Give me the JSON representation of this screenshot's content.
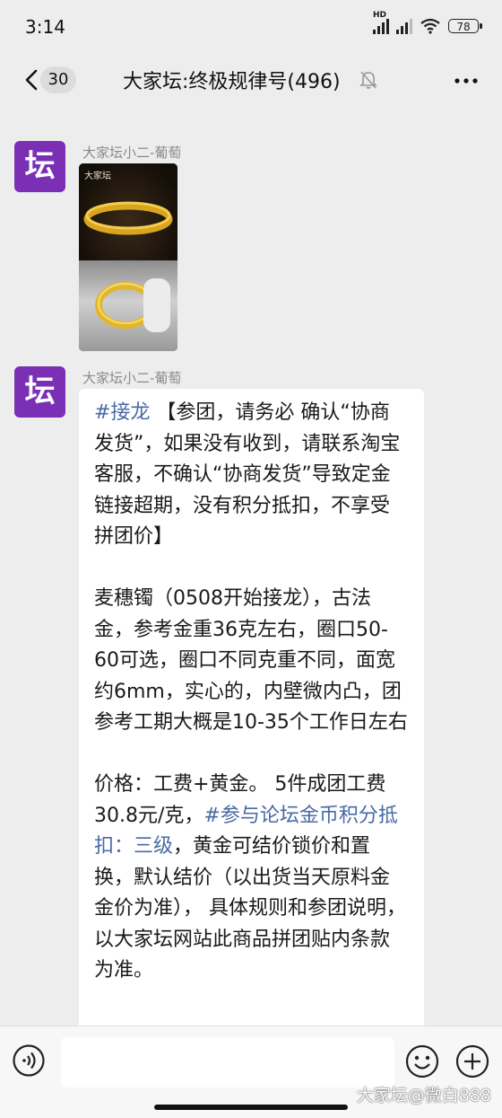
{
  "status_bar": {
    "time": "3:14",
    "network_label": "HD",
    "battery": "78",
    "icons": [
      "signal-icon",
      "signal-icon",
      "wifi-icon",
      "battery-icon"
    ]
  },
  "nav": {
    "back_count": "30",
    "title": "大家坛:终极规律号(496)",
    "icons": [
      "back-chevron-icon",
      "mute-bell-icon",
      "more-dots-icon"
    ]
  },
  "messages": [
    {
      "avatar_text": "坛",
      "sender": "大家坛小二-葡萄",
      "type": "image",
      "image_watermark": "大家坛",
      "image_description_icons": [
        "gold-bangle"
      ]
    },
    {
      "avatar_text": "坛",
      "sender": "大家坛小二-葡萄",
      "type": "text",
      "paragraphs": [
        {
          "tag": "#接龙",
          "text": " 【参团，请务必 确认“协商发货”，如果没有收到，请联系淘宝客服，不确认“协商发货”导致定金链接超期，没有积分抵扣，不享受拼团价】"
        },
        {
          "text": "麦穗镯（0508开始接龙），古法金，参考金重36克左右，圈口50-60可选，圈口不同克重不同，面宽约6mm，实心的，内壁微内凸，团参考工期大概是10-35个工作日左右"
        },
        {
          "text_before": "价格：工费+黄金。 5件成团工费30.8元/克，",
          "tag": "#参与论坛金币积分抵扣：三级",
          "text_after": "，黄金可结价锁价和置换，默认结价（以出货当天原料金金价为准）， 具体规则和参团说明，以大家坛网站此商品拼团贴内条款为准。"
        }
      ]
    }
  ],
  "input_bar": {
    "icons": [
      "voice-icon",
      "emoji-icon",
      "plus-icon"
    ],
    "text_value": ""
  },
  "watermark": "大家坛@微白888",
  "colors": {
    "background": "#ededed",
    "avatar": "#7a2fb5",
    "tag_link": "#4a6aa5",
    "bubble": "#ffffff"
  }
}
